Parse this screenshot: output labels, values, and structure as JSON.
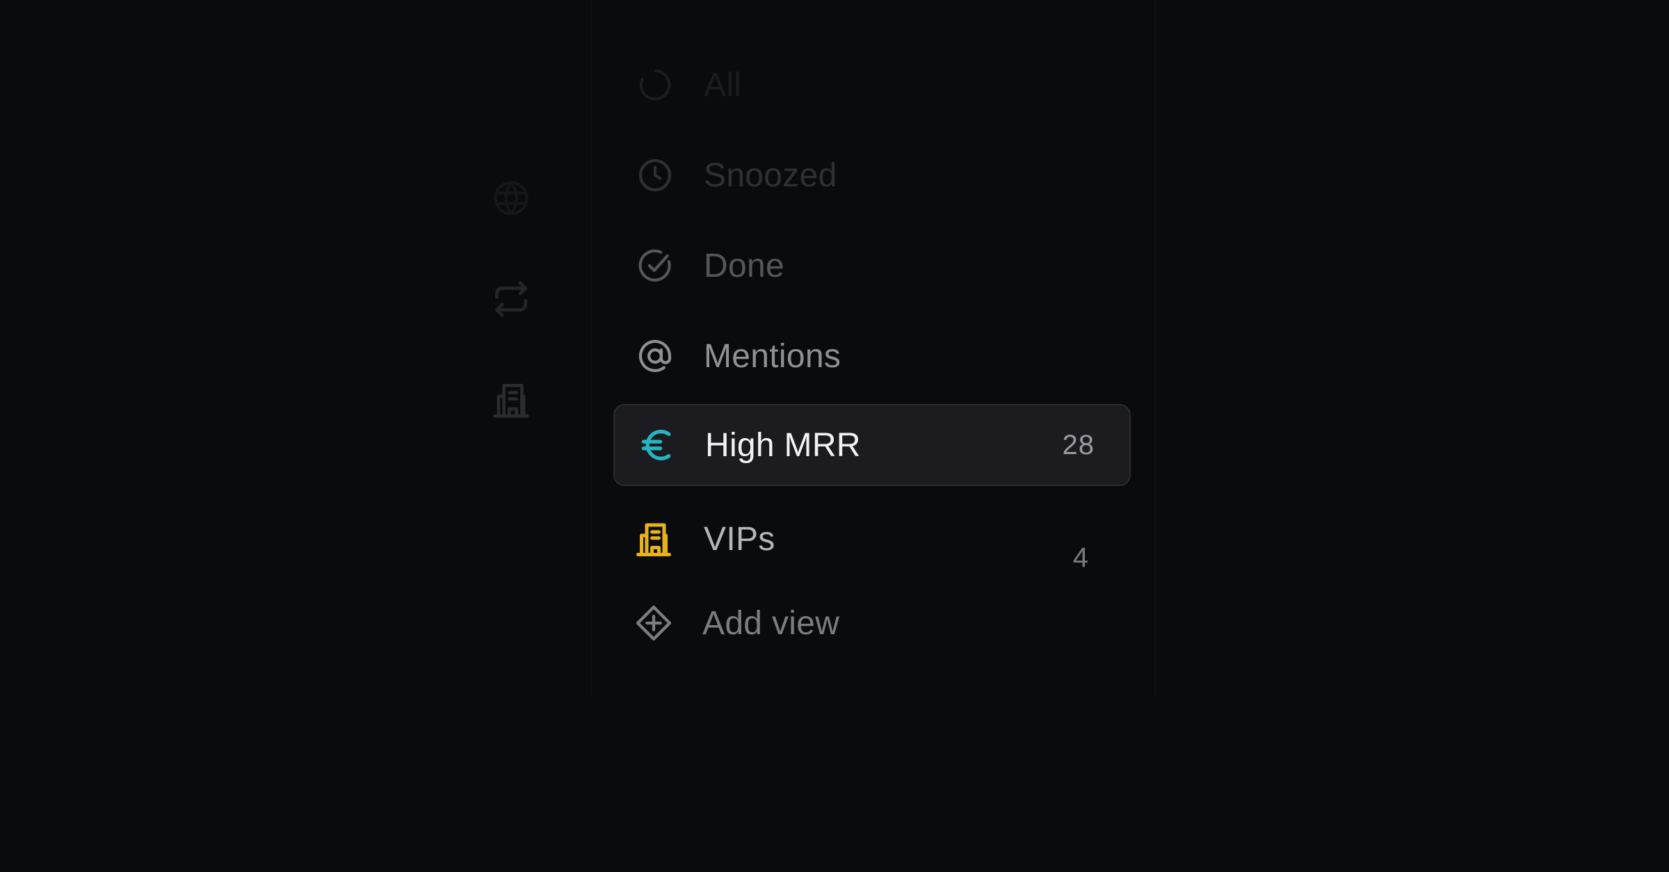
{
  "rail": {
    "icons": [
      "globe-icon",
      "repeat-icon",
      "building-icon"
    ]
  },
  "views": [
    {
      "label": "All",
      "count": "",
      "icon": "loader-icon",
      "color": "#1c1d21",
      "count_color": "#1a1b1e"
    },
    {
      "label": "Snoozed",
      "count": "",
      "icon": "clock-icon",
      "color": "#2e3034",
      "count_color": "#2e3034"
    },
    {
      "label": "Done",
      "count": "",
      "icon": "check-circle-icon",
      "color": "#55575c",
      "count_color": "#55575c"
    },
    {
      "label": "Mentions",
      "count": "",
      "icon": "at-icon",
      "color": "#8e9096",
      "count_color": "#8e9096"
    },
    {
      "label": "High MRR",
      "count": "28",
      "icon": "euro-icon",
      "color": "#f2f2f4",
      "count_color": "#9a9ca2",
      "icon_color": "#27b4bf",
      "selected": true
    },
    {
      "label": "VIPs",
      "count": "4",
      "icon": "building-icon",
      "color": "#b3b5ba",
      "count_color": "#7a7c82",
      "icon_color": "#e8b21b"
    }
  ],
  "add_view": {
    "label": "Add view",
    "icon": "plus-diamond-icon",
    "color": "#7b7d83"
  }
}
